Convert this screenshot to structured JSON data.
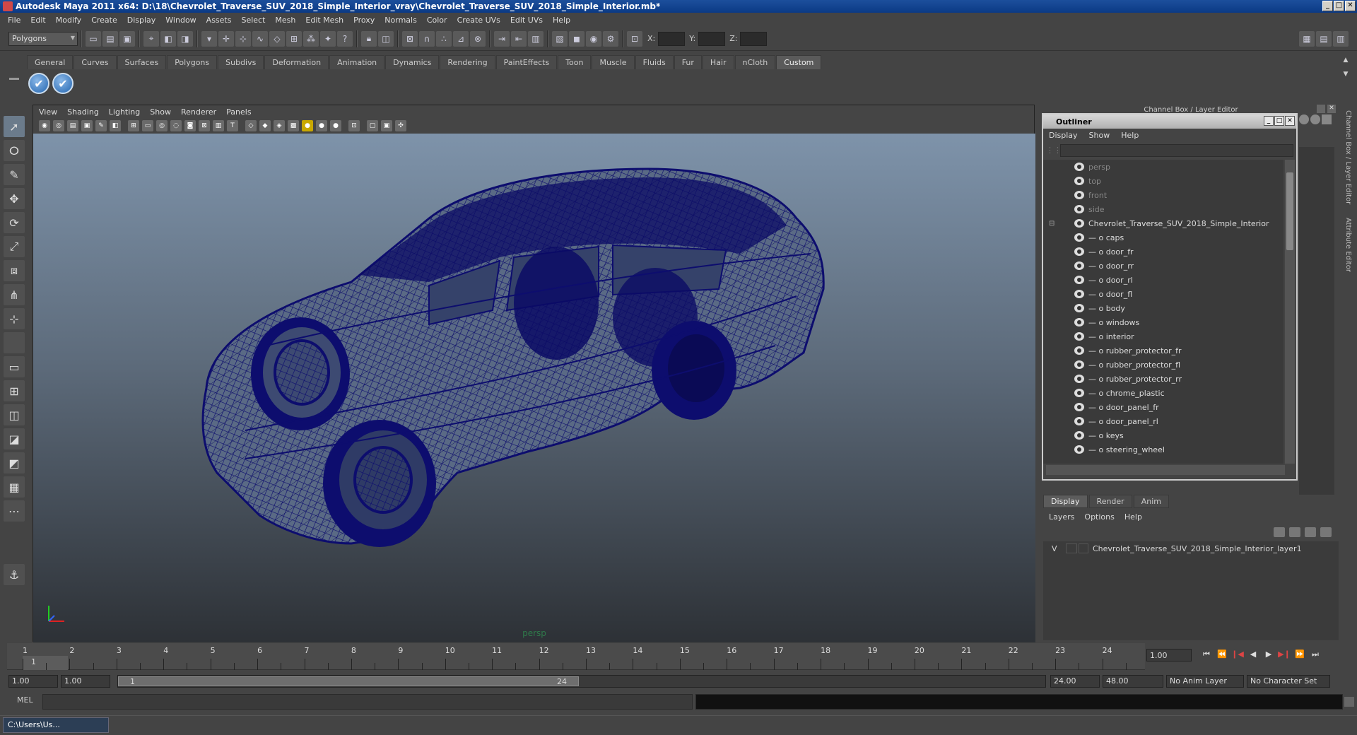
{
  "window": {
    "title": "Autodesk Maya 2011 x64: D:\\18\\Chevrolet_Traverse_SUV_2018_Simple_Interior_vray\\Chevrolet_Traverse_SUV_2018_Simple_Interior.mb*"
  },
  "menubar": [
    "File",
    "Edit",
    "Modify",
    "Create",
    "Display",
    "Window",
    "Assets",
    "Select",
    "Mesh",
    "Edit Mesh",
    "Proxy",
    "Normals",
    "Color",
    "Create UVs",
    "Edit UVs",
    "Help"
  ],
  "status": {
    "mode": "Polygons",
    "x_label": "X:",
    "y_label": "Y:",
    "z_label": "Z:"
  },
  "shelf": {
    "tabs": [
      "General",
      "Curves",
      "Surfaces",
      "Polygons",
      "Subdivs",
      "Deformation",
      "Animation",
      "Dynamics",
      "Rendering",
      "PaintEffects",
      "Toon",
      "Muscle",
      "Fluids",
      "Fur",
      "Hair",
      "nCloth",
      "Custom"
    ],
    "active": "Custom"
  },
  "viewport": {
    "menu": [
      "View",
      "Shading",
      "Lighting",
      "Show",
      "Renderer",
      "Panels"
    ],
    "camera": "persp",
    "wire_color": "#0d0d6e"
  },
  "channelbox": {
    "title": "Channel Box / Layer Editor"
  },
  "outliner": {
    "title": "Outliner",
    "menu": [
      "Display",
      "Show",
      "Help"
    ],
    "cameras": [
      "persp",
      "top",
      "front",
      "side"
    ],
    "group": "Chevrolet_Traverse_SUV_2018_Simple_Interior",
    "children": [
      "caps",
      "door_fr",
      "door_rr",
      "door_rl",
      "door_fl",
      "body",
      "windows",
      "interior",
      "rubber_protector_fr",
      "rubber_protector_fl",
      "rubber_protector_rr",
      "chrome_plastic",
      "door_panel_fr",
      "door_panel_rl",
      "keys",
      "steering_wheel"
    ]
  },
  "layer_editor": {
    "tabs": [
      "Display",
      "Render",
      "Anim"
    ],
    "menu": [
      "Layers",
      "Options",
      "Help"
    ],
    "layer_v": "V",
    "layer_name": "Chevrolet_Traverse_SUV_2018_Simple_Interior_layer1"
  },
  "right_strip": {
    "label1": "Channel Box / Layer Editor",
    "label2": "Attribute Editor"
  },
  "timeline": {
    "ticks": [
      "1",
      "2",
      "3",
      "4",
      "5",
      "6",
      "7",
      "8",
      "9",
      "10",
      "11",
      "12",
      "13",
      "14",
      "15",
      "16",
      "17",
      "18",
      "19",
      "20",
      "21",
      "22",
      "23",
      "24"
    ],
    "current_frame": "1.00",
    "current_marker": "1"
  },
  "range": {
    "start": "1.00",
    "play_start": "1.00",
    "slider_start": "1",
    "slider_end": "24",
    "play_end": "24.00",
    "end": "48.00",
    "anim_layer": "No Anim Layer",
    "char_set": "No Character Set"
  },
  "cmd": {
    "label": "MEL"
  },
  "taskbar": {
    "item": "C:\\Users\\Us..."
  }
}
